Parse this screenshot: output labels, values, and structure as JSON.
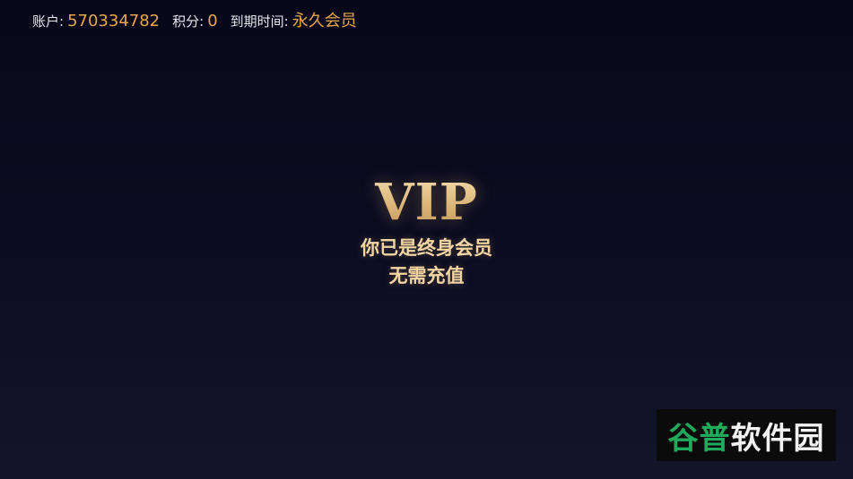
{
  "account": {
    "account_label": "账户:",
    "account_value": "570334782",
    "points_label": "积分:",
    "points_value": "0",
    "expiry_label": "到期时间:",
    "expiry_value": "永久会员"
  },
  "vip": {
    "title": "VIP",
    "line1": "你已是终身会员",
    "line2": "无需充值"
  },
  "watermark": {
    "green_text": "谷普",
    "white_text": "软件园"
  },
  "colors": {
    "accent": "#e8a64c",
    "gold": "#f3d6a3",
    "background": "#0c0c20",
    "watermark_green": "#1faa5c"
  }
}
